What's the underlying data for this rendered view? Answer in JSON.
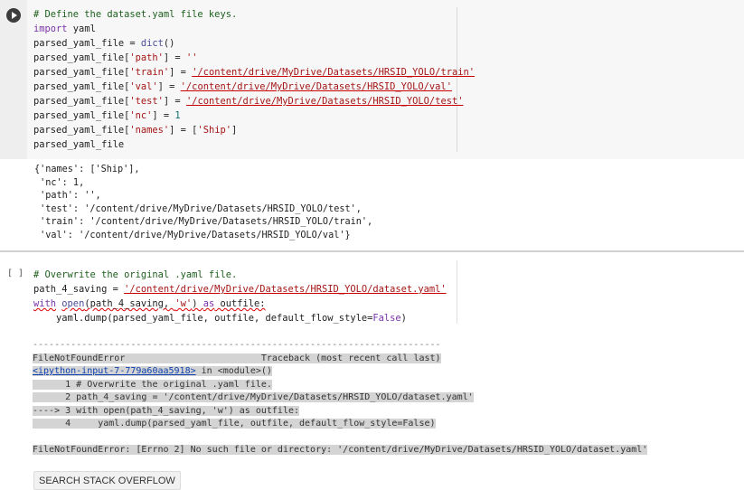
{
  "cell1": {
    "lines": [
      [
        {
          "t": "# Define the dataset.yaml file keys.",
          "c": "cm"
        }
      ],
      [
        {
          "t": "import",
          "c": "kw"
        },
        {
          "t": " yaml",
          "c": ""
        }
      ],
      [
        {
          "t": "parsed_yaml_file = ",
          "c": ""
        },
        {
          "t": "dict",
          "c": "fn"
        },
        {
          "t": "()",
          "c": ""
        }
      ],
      [
        {
          "t": "parsed_yaml_file[",
          "c": ""
        },
        {
          "t": "'path'",
          "c": "str"
        },
        {
          "t": "] = ",
          "c": ""
        },
        {
          "t": "''",
          "c": "str"
        }
      ],
      [
        {
          "t": "parsed_yaml_file[",
          "c": ""
        },
        {
          "t": "'train'",
          "c": "str"
        },
        {
          "t": "] = ",
          "c": ""
        },
        {
          "t": "'/content/drive/MyDrive/Datasets/HRSID_YOLO/train'",
          "c": "path"
        }
      ],
      [
        {
          "t": "parsed_yaml_file[",
          "c": ""
        },
        {
          "t": "'val'",
          "c": "str"
        },
        {
          "t": "] = ",
          "c": ""
        },
        {
          "t": "'/content/drive/MyDrive/Datasets/HRSID_YOLO/val'",
          "c": "path"
        }
      ],
      [
        {
          "t": "parsed_yaml_file[",
          "c": ""
        },
        {
          "t": "'test'",
          "c": "str"
        },
        {
          "t": "] = ",
          "c": ""
        },
        {
          "t": "'/content/drive/MyDrive/Datasets/HRSID_YOLO/test'",
          "c": "path"
        }
      ],
      [
        {
          "t": "parsed_yaml_file[",
          "c": ""
        },
        {
          "t": "'nc'",
          "c": "str"
        },
        {
          "t": "] = ",
          "c": ""
        },
        {
          "t": "1",
          "c": "num"
        }
      ],
      [
        {
          "t": "parsed_yaml_file[",
          "c": ""
        },
        {
          "t": "'names'",
          "c": "str"
        },
        {
          "t": "] = [",
          "c": ""
        },
        {
          "t": "'Ship'",
          "c": "str"
        },
        {
          "t": "]",
          "c": ""
        }
      ],
      [
        {
          "t": "parsed_yaml_file",
          "c": ""
        }
      ]
    ]
  },
  "output1": {
    "lines": [
      "{'names': ['Ship'],",
      " 'nc': 1,",
      " 'path': '',",
      " 'test': '/content/drive/MyDrive/Datasets/HRSID_YOLO/test',",
      " 'train': '/content/drive/MyDrive/Datasets/HRSID_YOLO/train',",
      " 'val': '/content/drive/MyDrive/Datasets/HRSID_YOLO/val'}"
    ]
  },
  "cell2": {
    "bracket": "[ ]",
    "lines": [
      [
        {
          "t": "# Overwrite the original .yaml file.",
          "c": "cm"
        }
      ],
      [
        {
          "t": "path_4_saving = ",
          "c": ""
        },
        {
          "t": "'/content/drive/MyDrive/Datasets/HRSID_YOLO/dataset.yaml'",
          "c": "path"
        }
      ],
      [
        {
          "t": "with",
          "c": "kw squig"
        },
        {
          "t": " ",
          "c": ""
        },
        {
          "t": "open",
          "c": "fn squig"
        },
        {
          "t": "(path_4_saving, ",
          "c": "squig"
        },
        {
          "t": "'w'",
          "c": "str squig"
        },
        {
          "t": ") ",
          "c": "squig"
        },
        {
          "t": "as",
          "c": "kw squig"
        },
        {
          "t": " outfile:",
          "c": "squig"
        }
      ],
      [
        {
          "t": "    yaml.dump(parsed_yaml_file, outfile, default_flow_style=",
          "c": ""
        },
        {
          "t": "False",
          "c": "kw"
        },
        {
          "t": ")",
          "c": ""
        }
      ]
    ]
  },
  "traceback": {
    "dashes": "---------------------------------------------------------------------------",
    "header_left": "FileNotFoundError",
    "header_right": "Traceback (most recent call last)",
    "input_link": "<ipython-input-7-779a60aa5918>",
    "in_module": " in <module>()",
    "frames": [
      "      1 # Overwrite the original .yaml file.",
      "      2 path_4_saving = '/content/drive/MyDrive/Datasets/HRSID_YOLO/dataset.yaml'",
      "----> 3 with open(path_4_saving, 'w') as outfile:",
      "      4     yaml.dump(parsed_yaml_file, outfile, default_flow_style=False)"
    ],
    "error": "FileNotFoundError: [Errno 2] No such file or directory: '/content/drive/MyDrive/Datasets/HRSID_YOLO/dataset.yaml'"
  },
  "search_button": "SEARCH STACK OVERFLOW"
}
